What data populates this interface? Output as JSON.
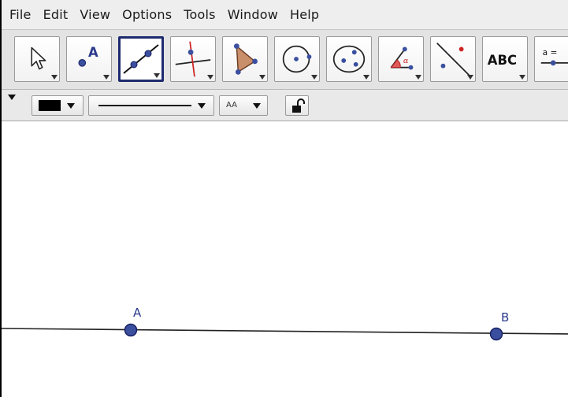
{
  "menubar": {
    "items": [
      {
        "label": "File"
      },
      {
        "label": "Edit"
      },
      {
        "label": "View"
      },
      {
        "label": "Options"
      },
      {
        "label": "Tools"
      },
      {
        "label": "Window"
      },
      {
        "label": "Help"
      }
    ]
  },
  "toolbar": {
    "text_tool_label": "ABC",
    "slider_tool_label": "a =",
    "selected_tool": "line-through-two-points",
    "tools": [
      {
        "name": "move-tool",
        "icon": "arrow-pointer-icon"
      },
      {
        "name": "point-tool",
        "icon": "point-a-icon"
      },
      {
        "name": "line-tool",
        "icon": "line-through-two-points-icon"
      },
      {
        "name": "perpendicular-line-tool",
        "icon": "perpendicular-line-icon"
      },
      {
        "name": "polygon-tool",
        "icon": "polygon-icon"
      },
      {
        "name": "circle-tool",
        "icon": "circle-center-point-icon"
      },
      {
        "name": "conic-tool",
        "icon": "ellipse-icon"
      },
      {
        "name": "angle-tool",
        "icon": "angle-alpha-icon"
      },
      {
        "name": "reflect-tool",
        "icon": "reflect-about-line-icon"
      },
      {
        "name": "text-tool",
        "icon": "text-abc-icon"
      },
      {
        "name": "slider-tool",
        "icon": "slider-icon"
      }
    ]
  },
  "stylebar": {
    "color_value": "#000000",
    "line_style": "solid",
    "label_style_text": "AA",
    "lock_state": "unlocked"
  },
  "canvas": {
    "points": [
      {
        "label": "A",
        "color": "#3a4f9e"
      },
      {
        "label": "B",
        "color": "#3a4f9e"
      }
    ],
    "line_color": "#222222"
  }
}
